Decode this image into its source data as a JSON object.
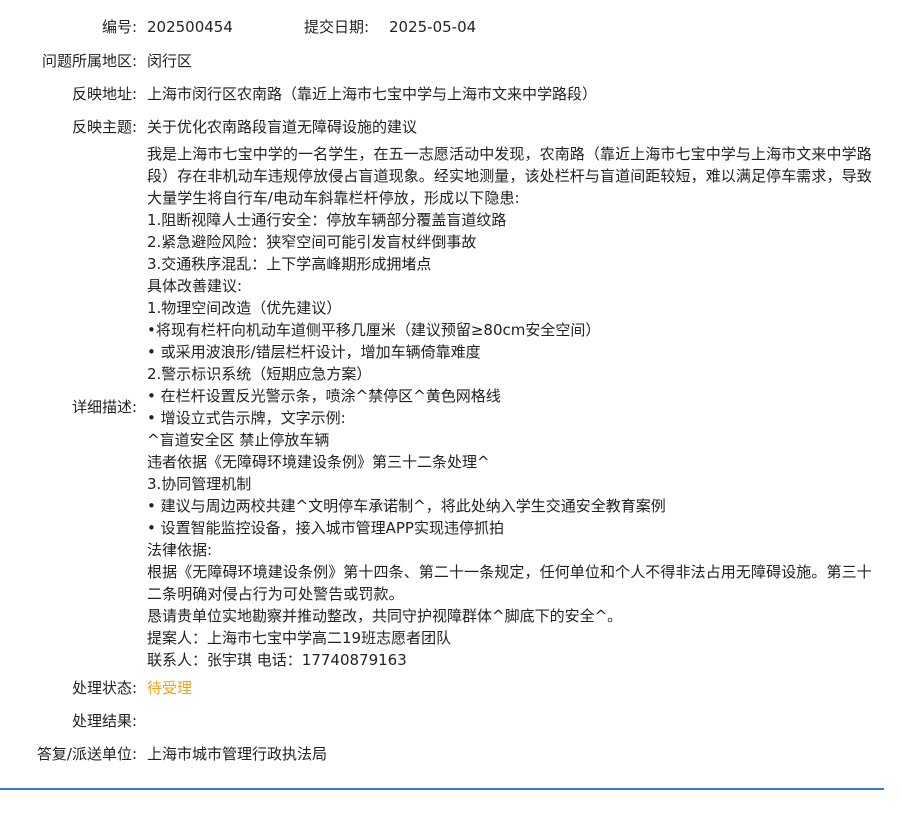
{
  "record": {
    "id_label": "编号:",
    "id_value": "202500454",
    "date_label": "提交日期:",
    "date_value": "2025-05-04",
    "region_label": "问题所属地区:",
    "region_value": "闵行区",
    "address_label": "反映地址:",
    "address_value": "上海市闵行区农南路（靠近上海市七宝中学与上海市文来中学路段）",
    "subject_label": "反映主题:",
    "subject_value": "关于优化农南路段盲道无障碍设施的建议",
    "description_label": "详细描述:",
    "description_intro": "我是上海市七宝中学的一名学生，在五一志愿活动中发现，农南路（靠近上海市七宝中学与上海市文来中学路段）存在非机动车违规停放侵占盲道现象。经实地测量，该处栏杆与盲道间距较短，难以满足停车需求，导致大量学生将自行车/电动车斜靠栏杆停放，形成以下隐患:",
    "description_lines": [
      "1.阻断视障人士通行安全：停放车辆部分覆盖盲道纹路",
      "2.紧急避险风险：狭窄空间可能引发盲杖绊倒事故",
      "3.交通秩序混乱：上下学高峰期形成拥堵点",
      "具体改善建议:",
      "1.物理空间改造（优先建议）",
      "•将现有栏杆向机动车道侧平移几厘米（建议预留≥80cm安全空间）",
      "• 或采用波浪形/错层栏杆设计，增加车辆倚靠难度",
      "2.警示标识系统（短期应急方案）",
      "• 在栏杆设置反光警示条，喷涂^禁停区^黄色网格线",
      "• 增设立式告示牌，文字示例:",
      "^盲道安全区 禁止停放车辆",
      "违者依据《无障碍环境建设条例》第三十二条处理^",
      "3.协同管理机制",
      "• 建议与周边两校共建^文明停车承诺制^，将此处纳入学生交通安全教育案例",
      "• 设置智能监控设备，接入城市管理APP实现违停抓拍",
      "法律依据:"
    ],
    "legal_text": "根据《无障碍环境建设条例》第十四条、第二十一条规定，任何单位和个人不得非法占用无障碍设施。第三十二条明确对侵占行为可处警告或罚款。",
    "closing_lines": [
      "恳请贵单位实地勘察并推动整改，共同守护视障群体^脚底下的安全^。",
      "提案人：上海市七宝中学高二19班志愿者团队",
      "联系人：张宇琪 电话：17740879163"
    ],
    "status_label": "处理状态:",
    "status_value": "待受理",
    "result_label": "处理结果:",
    "result_value": "",
    "dept_label": "答复/派送单位:",
    "dept_value": "上海市城市管理行政执法局"
  },
  "colors": {
    "status": "#f0a020",
    "divider": "#3a7bd5",
    "text": "#222222"
  }
}
